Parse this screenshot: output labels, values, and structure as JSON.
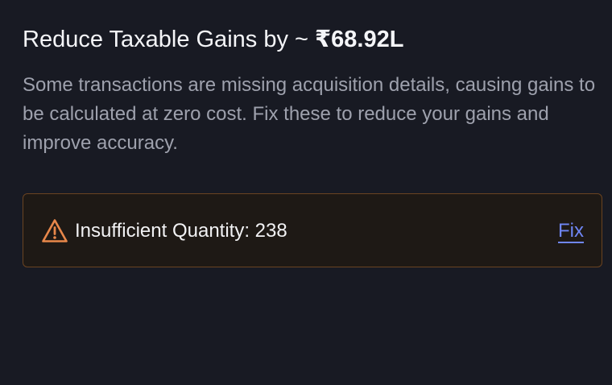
{
  "header": {
    "title_prefix": "Reduce Taxable Gains by ~ ",
    "title_amount": "₹68.92L"
  },
  "description": "Some transactions are missing acquisition details, causing gains to be calculated at zero cost. Fix these to reduce your gains and improve accuracy.",
  "alert": {
    "icon": "warning-triangle-icon",
    "label": "Insufficient Quantity: 238",
    "action_label": "Fix",
    "colors": {
      "border": "#6a4321",
      "icon": "#e8874a",
      "link": "#6f86f5"
    }
  }
}
